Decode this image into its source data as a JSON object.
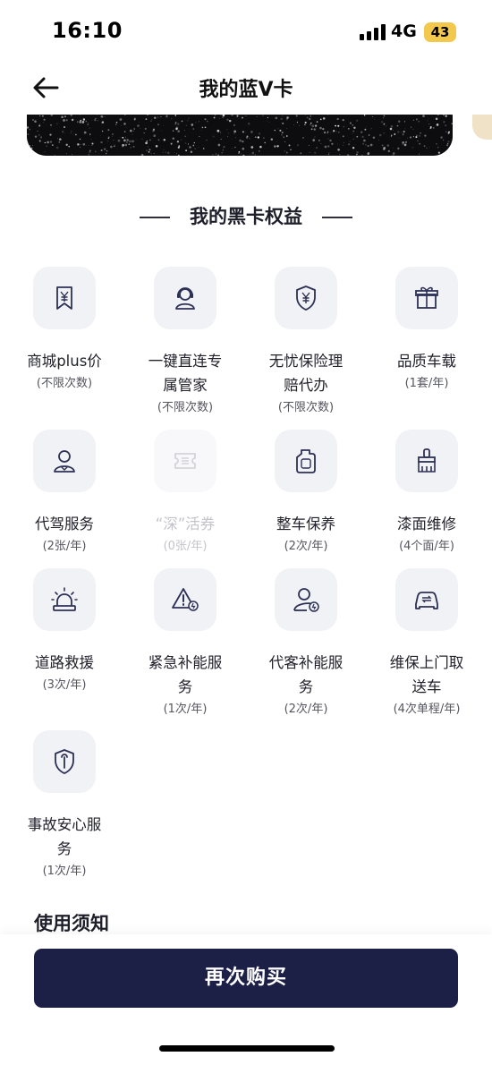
{
  "status_bar": {
    "time": "16:10",
    "network": "4G",
    "battery": "43"
  },
  "nav": {
    "title": "我的蓝Ⅴ卡"
  },
  "section": {
    "title": "我的黑卡权益"
  },
  "benefits": [
    {
      "name": "商城plus价",
      "sub": "(不限次数)",
      "icon": "yen-bookmark-icon"
    },
    {
      "name": "一键直连专属管家",
      "sub": "(不限次数)",
      "icon": "butler-headset-icon"
    },
    {
      "name": "无忧保险理赔代办",
      "sub": "(不限次数)",
      "icon": "yen-shield-icon"
    },
    {
      "name": "品质车载",
      "sub": "(1套/年)",
      "icon": "gift-box-icon"
    },
    {
      "name": "代驾服务",
      "sub": "(2张/年)",
      "icon": "driver-person-icon"
    },
    {
      "name": "“深”活券",
      "sub": "(0张/年)",
      "icon": "ticket-icon"
    },
    {
      "name": "整车保养",
      "sub": "(2次/年)",
      "icon": "oil-bottle-icon"
    },
    {
      "name": "漆面维修",
      "sub": "(4个面/年)",
      "icon": "paint-brush-icon"
    },
    {
      "name": "道路救援",
      "sub": "(3次/年)",
      "icon": "siren-light-icon"
    },
    {
      "name": "紧急补能服务",
      "sub": "(1次/年)",
      "icon": "warning-charge-icon"
    },
    {
      "name": "代客补能服务",
      "sub": "(2次/年)",
      "icon": "person-charge-icon"
    },
    {
      "name": "维保上门取送车",
      "sub": "(4次单程/年)",
      "icon": "car-exchange-icon"
    },
    {
      "name": "事故安心服务",
      "sub": "(1次/年)",
      "icon": "wrench-shield-icon"
    }
  ],
  "notes": {
    "title": "使用须知"
  },
  "buy_button": {
    "label": "再次购买"
  },
  "colors": {
    "accent": "#1c1f46",
    "icon_bg": "#f1f2f6",
    "battery": "#f2c94c"
  }
}
